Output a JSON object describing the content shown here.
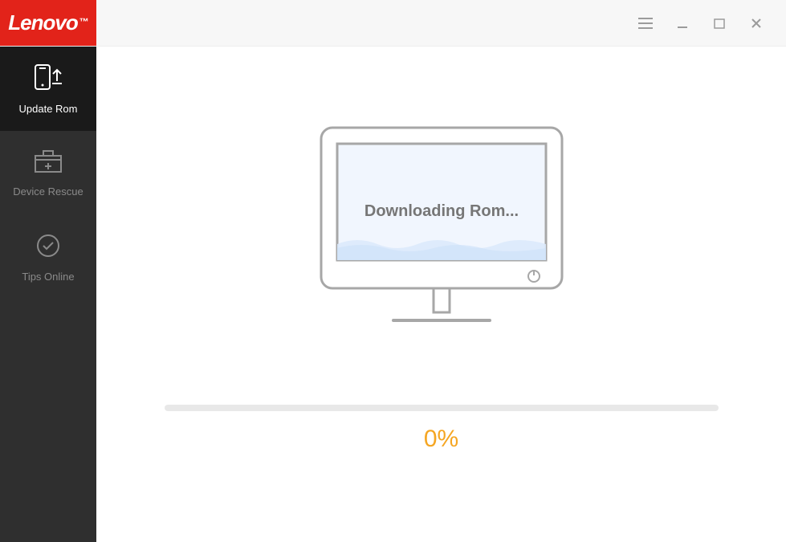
{
  "brand": "Lenovo",
  "sidebar": {
    "items": [
      {
        "label": "Update Rom"
      },
      {
        "label": "Device Rescue"
      },
      {
        "label": "Tips Online"
      }
    ]
  },
  "main": {
    "status_text": "Downloading Rom...",
    "progress_percent": "0%",
    "progress_value": 0
  }
}
